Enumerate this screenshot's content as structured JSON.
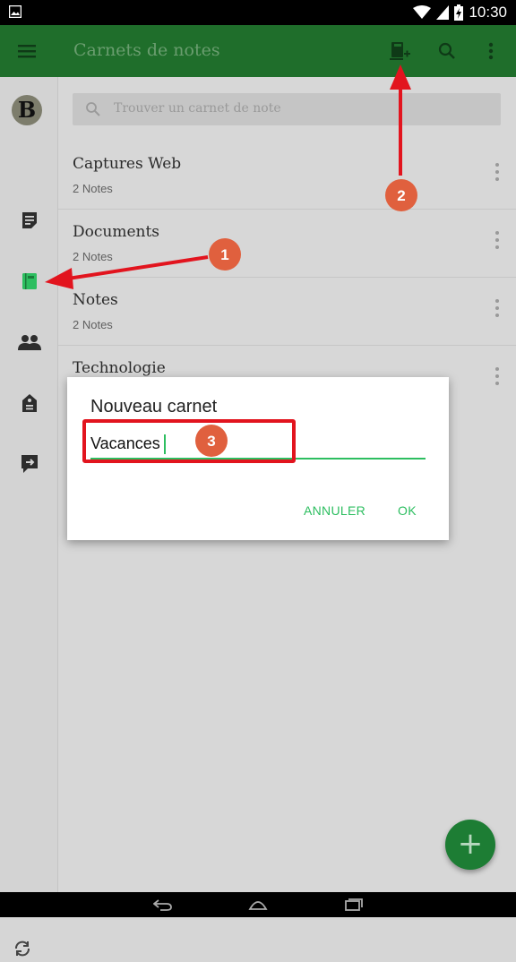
{
  "status_bar": {
    "time": "10:30"
  },
  "toolbar": {
    "title": "Carnets de notes",
    "icons": [
      "menu-icon",
      "new-notebook-icon",
      "search-icon",
      "more-vert-icon"
    ]
  },
  "sidebar": {
    "avatar_letter": "B",
    "items": [
      "notes-icon",
      "notebooks-icon",
      "shared-icon",
      "tags-icon",
      "work-chat-icon"
    ],
    "active_color": "#2dbe60"
  },
  "search": {
    "placeholder": "Trouver un carnet de note"
  },
  "notebooks": [
    {
      "name": "Captures Web",
      "count": "2 Notes"
    },
    {
      "name": "Documents",
      "count": "2 Notes"
    },
    {
      "name": "Notes",
      "count": "2 Notes"
    },
    {
      "name": "Technologie",
      "count": ""
    }
  ],
  "dialog": {
    "title": "Nouveau carnet",
    "value": "Vacances",
    "cancel_label": "ANNULER",
    "ok_label": "OK"
  },
  "fab": {
    "label": "+"
  },
  "annotations": {
    "badge1": "1",
    "badge2": "2",
    "badge3": "3",
    "color": "#e2141e",
    "badge_color": "#e0603e"
  },
  "colors": {
    "toolbar": "#1f6e2b",
    "accent": "#2dbe60"
  }
}
